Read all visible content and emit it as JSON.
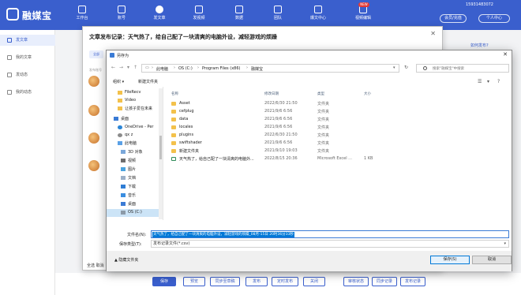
{
  "app": {
    "logo_text": "融媒宝",
    "phone": "15931483072",
    "member_center": "会员/充值",
    "personal_center": "个人中心"
  },
  "nav": {
    "items": [
      {
        "label": "工作台"
      },
      {
        "label": "账号"
      },
      {
        "label": "发文章"
      },
      {
        "label": "发视频"
      },
      {
        "label": "数据"
      },
      {
        "label": "团队"
      },
      {
        "label": "爆文中心"
      },
      {
        "label": "视频编辑"
      }
    ],
    "new_badge": "NEW"
  },
  "sidebar": {
    "items": [
      {
        "label": "发文章"
      },
      {
        "label": "我的文章"
      },
      {
        "label": "发动态"
      },
      {
        "label": "我的动态"
      }
    ]
  },
  "main": {
    "right_link": "如何发布?",
    "select_all": "全选 取消"
  },
  "publish_dialog": {
    "title": "文章发布记录：天气热了，给自己配了一块清爽的电脑外设，减轻游戏的烦躁",
    "close": "✕",
    "tab": "全部",
    "list_label": "发布账号"
  },
  "save_as": {
    "title": "另存为",
    "close": "✕",
    "breadcrumb": [
      "此电脑",
      "OS (C:)",
      "Program Files (x86)",
      "融媒宝"
    ],
    "search_placeholder": "搜索\"融媒宝\"中搜索",
    "organize": "组织 ▾",
    "new_folder": "新建文件夹",
    "nav_items": [
      {
        "label": "FileRecv",
        "icon": "folder"
      },
      {
        "label": "Video",
        "icon": "folder"
      },
      {
        "label": "让孩子爱在未来",
        "icon": "folder"
      },
      {
        "label": "桌面",
        "icon": "desktop"
      },
      {
        "label": "OneDrive - Per",
        "icon": "cloud"
      },
      {
        "label": "qx z",
        "icon": "user"
      },
      {
        "label": "此电脑",
        "icon": "pc"
      },
      {
        "label": "3D 对象",
        "icon": "3d"
      },
      {
        "label": "视频",
        "icon": "video"
      },
      {
        "label": "图片",
        "icon": "image"
      },
      {
        "label": "文档",
        "icon": "doc"
      },
      {
        "label": "下载",
        "icon": "download"
      },
      {
        "label": "音乐",
        "icon": "music"
      },
      {
        "label": "桌面",
        "icon": "desktop"
      },
      {
        "label": "OS (C:)",
        "icon": "drive"
      }
    ],
    "columns": {
      "name": "名称",
      "date": "修改日期",
      "type": "类型",
      "size": "大小"
    },
    "files": [
      {
        "name": "Asset",
        "date": "2022/6/30 21:50",
        "type": "文件夹",
        "size": "",
        "kind": "folder"
      },
      {
        "name": "cefplug",
        "date": "2021/9/6 6:56",
        "type": "文件夹",
        "size": "",
        "kind": "folder"
      },
      {
        "name": "data",
        "date": "2021/9/6 6:56",
        "type": "文件夹",
        "size": "",
        "kind": "folder"
      },
      {
        "name": "locales",
        "date": "2021/9/6 6:56",
        "type": "文件夹",
        "size": "",
        "kind": "folder"
      },
      {
        "name": "plugins",
        "date": "2022/6/30 21:50",
        "type": "文件夹",
        "size": "",
        "kind": "folder"
      },
      {
        "name": "swiftshader",
        "date": "2021/9/6 6:56",
        "type": "文件夹",
        "size": "",
        "kind": "folder"
      },
      {
        "name": "新建文件夹",
        "date": "2021/9/10 19:03",
        "type": "文件夹",
        "size": "",
        "kind": "folder"
      },
      {
        "name": "天气热了，给自己配了一块清爽的电脑外...",
        "date": "2022/8/15 20:36",
        "type": "Microsoft Excel ...",
        "size": "1 KB",
        "kind": "excel"
      }
    ],
    "filename_label": "文件名(N):",
    "filename_value": "天气热了，给自己配了一块清爽的电脑外设，减轻游戏的烦躁_08月-15日 20时36分33秒",
    "filetype_label": "保存类型(T):",
    "filetype_value": "发布记录文件(*.csv)",
    "hide_folders": "▲ 隐藏文件夹",
    "save_btn": "保存(S)",
    "cancel_btn": "取消"
  },
  "bottom": {
    "buttons": [
      {
        "label": "保存",
        "primary": true
      },
      {
        "label": "预览"
      },
      {
        "label": "同步至草稿"
      },
      {
        "label": "发布"
      },
      {
        "label": "定时发布"
      },
      {
        "label": "关闭"
      },
      {
        "label": "审核状态"
      },
      {
        "label": "同步记录"
      },
      {
        "label": "发布记录"
      }
    ]
  }
}
